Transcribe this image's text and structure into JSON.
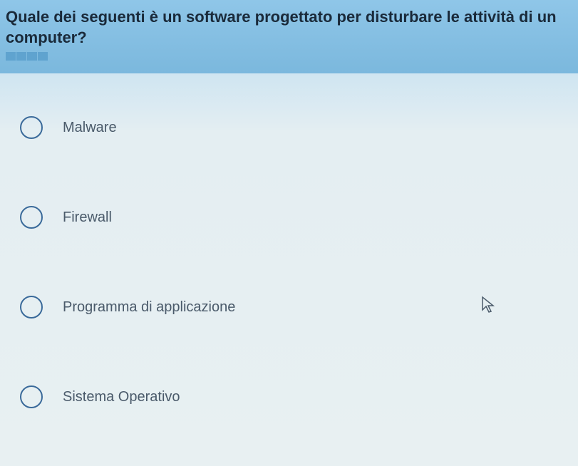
{
  "question": {
    "text": "Quale dei seguenti è un software progettato per disturbare le attività di un computer?",
    "progress_segments": 4
  },
  "options": [
    {
      "label": "Malware"
    },
    {
      "label": "Firewall"
    },
    {
      "label": "Programma di applicazione"
    },
    {
      "label": "Sistema Operativo"
    }
  ]
}
